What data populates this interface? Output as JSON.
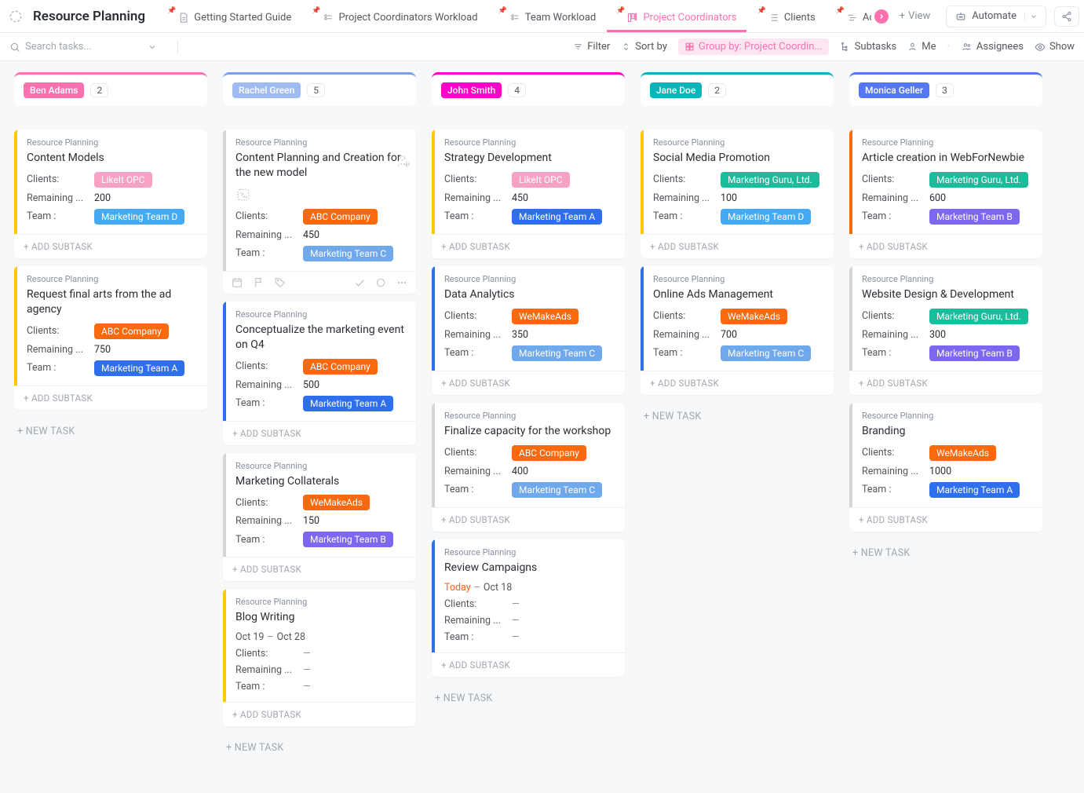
{
  "header": {
    "title": "Resource Planning",
    "views": [
      {
        "label": "Getting Started Guide",
        "icon": "doc",
        "active": false
      },
      {
        "label": "Project Coordinators Workload",
        "icon": "workload",
        "active": false
      },
      {
        "label": "Team Workload",
        "icon": "workload",
        "active": false
      },
      {
        "label": "Project Coordinators",
        "icon": "board",
        "active": true
      },
      {
        "label": "Clients",
        "icon": "list",
        "active": false
      },
      {
        "label": "Activity Gant",
        "icon": "gantt",
        "active": false
      }
    ],
    "add_view_label": "View",
    "automate_label": "Automate"
  },
  "toolbar": {
    "search_placeholder": "Search tasks...",
    "filter": "Filter",
    "sort": "Sort by",
    "group": "Group by: Project Coordin...",
    "subtasks": "Subtasks",
    "me": "Me",
    "assignees": "Assignees",
    "show": "Show"
  },
  "labels": {
    "crumb": "Resource Planning",
    "clients": "Clients:",
    "remaining": "Remaining ...",
    "team": "Team :",
    "add_subtask": "ADD SUBTASK",
    "new_task": "NEW TASK"
  },
  "tag_colors": {
    "LikeIt OPC": "c-pink-soft",
    "ABC Company": "c-orange",
    "WeMakeAds": "c-orange",
    "Marketing Guru, Ltd.": "c-teal",
    "Marketing Team A": "c-blue",
    "Marketing Team B": "c-purple",
    "Marketing Team C": "c-blue-soft",
    "Marketing Team D": "c-ltblue"
  },
  "columns": [
    {
      "name": "Ben Adams",
      "count": "2",
      "bar_color": "#fd71af",
      "pill_bg": "#fd71af",
      "cards": [
        {
          "title": "Content Models",
          "stripe": "#ffc800",
          "client": "LikeIt OPC",
          "remaining": "200",
          "team": "Marketing Team D"
        },
        {
          "title": "Request final arts from the ad agency",
          "stripe": "#ffc800",
          "client": "ABC Company",
          "remaining": "750",
          "team": "Marketing Team A"
        }
      ]
    },
    {
      "name": "Rachel Green",
      "count": "5",
      "bar_color": "#7b9ff0",
      "pill_bg": "#9fbcf2",
      "cards": [
        {
          "title": "Content Planning and Creation for the new model",
          "stripe": "#d5d6d8",
          "client": "ABC Company",
          "remaining": "450",
          "team": "Marketing Team C",
          "hovered": true
        },
        {
          "title": "Conceptualize the marketing event on Q4",
          "stripe": "#2f6fed",
          "client": "ABC Company",
          "remaining": "500",
          "team": "Marketing Team A"
        },
        {
          "title": "Marketing Collaterals",
          "stripe": "#d5d6d8",
          "client": "WeMakeAds",
          "remaining": "150",
          "team": "Marketing Team B"
        },
        {
          "title": "Blog Writing",
          "stripe": "#ffc800",
          "dates": {
            "start": "Oct 19",
            "end": "Oct 28"
          },
          "client": "—",
          "remaining": "—",
          "team": "—",
          "empty_values": true
        }
      ]
    },
    {
      "name": "John Smith",
      "count": "4",
      "bar_color": "#fc01c6",
      "pill_bg": "#fc01c6",
      "cards": [
        {
          "title": "Strategy Development",
          "stripe": "#ffc800",
          "client": "LikeIt OPC",
          "remaining": "450",
          "team": "Marketing Team A"
        },
        {
          "title": "Data Analytics",
          "stripe": "#2f6fed",
          "client": "WeMakeAds",
          "remaining": "350",
          "team": "Marketing Team C"
        },
        {
          "title": "Finalize capacity for the workshop",
          "stripe": "#d5d6d8",
          "client": "ABC Company",
          "remaining": "400",
          "team": "Marketing Team C"
        },
        {
          "title": "Review Campaigns",
          "stripe": "#2f6fed",
          "dates": {
            "start": "Today",
            "end": "Oct 18",
            "start_today": true
          },
          "client": "—",
          "remaining": "—",
          "team": "—",
          "empty_values": true
        }
      ]
    },
    {
      "name": "Jane Doe",
      "count": "2",
      "bar_color": "#0ab4ba",
      "pill_bg": "#0ab4ba",
      "cards": [
        {
          "title": "Social Media Promotion",
          "stripe": "#ffc800",
          "client": "Marketing Guru, Ltd.",
          "remaining": "100",
          "team": "Marketing Team D"
        },
        {
          "title": "Online Ads Management",
          "stripe": "#2f6fed",
          "client": "WeMakeAds",
          "remaining": "700",
          "team": "Marketing Team C"
        }
      ]
    },
    {
      "name": "Monica Geller",
      "count": "3",
      "bar_color": "#5577f2",
      "pill_bg": "#5577f2",
      "cards": [
        {
          "title": "Article creation in WebForNewbie",
          "stripe": "#f9690e",
          "client": "Marketing Guru, Ltd.",
          "remaining": "600",
          "team": "Marketing Team B"
        },
        {
          "title": "Website Design & Development",
          "stripe": "#d5d6d8",
          "client": "Marketing Guru, Ltd.",
          "remaining": "300",
          "team": "Marketing Team B"
        },
        {
          "title": "Branding",
          "stripe": "#d5d6d8",
          "client": "WeMakeAds",
          "remaining": "1000",
          "team": "Marketing Team A"
        }
      ]
    }
  ]
}
